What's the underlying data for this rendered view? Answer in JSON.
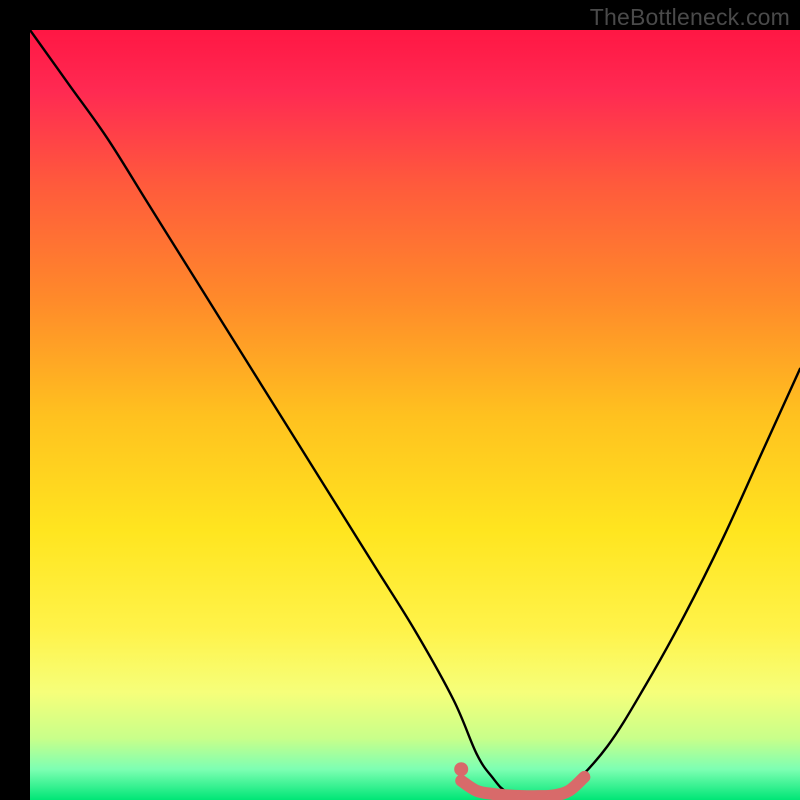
{
  "attribution": "TheBottleneck.com",
  "chart_data": {
    "type": "line",
    "title": "",
    "xlabel": "",
    "ylabel": "",
    "xlim": [
      0,
      100
    ],
    "ylim": [
      0,
      100
    ],
    "series": [
      {
        "name": "curve",
        "x": [
          0,
          5,
          10,
          15,
          20,
          25,
          30,
          35,
          40,
          45,
          50,
          55,
          58,
          60,
          62,
          65,
          68,
          70,
          75,
          80,
          85,
          90,
          95,
          100
        ],
        "y": [
          100,
          93,
          86,
          78,
          70,
          62,
          54,
          46,
          38,
          30,
          22,
          13,
          6,
          3,
          1,
          0.5,
          0.5,
          1.5,
          7,
          15,
          24,
          34,
          45,
          56
        ]
      },
      {
        "name": "optimal-band",
        "x": [
          56,
          58,
          60,
          62,
          64,
          66,
          68,
          70,
          72
        ],
        "y": [
          2.5,
          1.2,
          0.8,
          0.6,
          0.5,
          0.5,
          0.6,
          1.2,
          3.0
        ]
      }
    ],
    "gradient_stops": [
      {
        "offset": 0.0,
        "color": "#ff1744"
      },
      {
        "offset": 0.08,
        "color": "#ff2a52"
      },
      {
        "offset": 0.2,
        "color": "#ff5a3c"
      },
      {
        "offset": 0.35,
        "color": "#ff8a2a"
      },
      {
        "offset": 0.5,
        "color": "#ffc11f"
      },
      {
        "offset": 0.65,
        "color": "#ffe51f"
      },
      {
        "offset": 0.78,
        "color": "#fff34a"
      },
      {
        "offset": 0.86,
        "color": "#f6ff7a"
      },
      {
        "offset": 0.92,
        "color": "#c8ff8a"
      },
      {
        "offset": 0.96,
        "color": "#7dffb3"
      },
      {
        "offset": 1.0,
        "color": "#00e676"
      }
    ],
    "colors": {
      "curve": "#000000",
      "optimal": "#d86a6a",
      "marker": "#d86a6a"
    },
    "marker_point": {
      "x": 56,
      "y": 4
    }
  }
}
